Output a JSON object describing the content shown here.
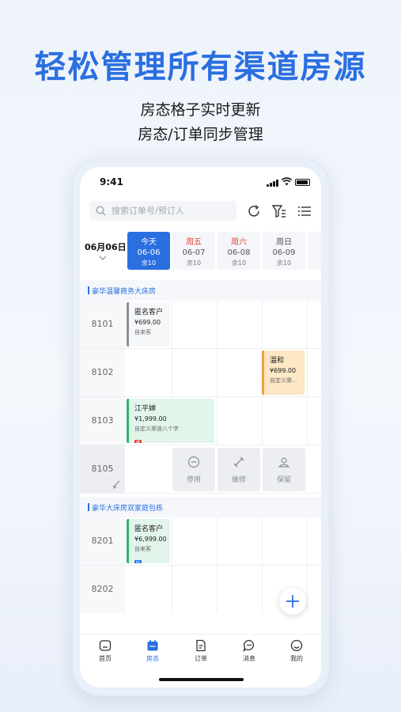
{
  "headline": "轻松管理所有渠道房源",
  "subline1": "房态格子实时更新",
  "subline2": "房态/订单同步管理",
  "status_bar": {
    "time": "9:41"
  },
  "search": {
    "placeholder": "搜索订单号/预订人"
  },
  "current_date": "06月06日",
  "dates": [
    {
      "weekday": "今天",
      "date": "06-06",
      "remain": "余10"
    },
    {
      "weekday": "周五",
      "date": "06-07",
      "remain": "余10"
    },
    {
      "weekday": "周六",
      "date": "06-08",
      "remain": "余10"
    },
    {
      "weekday": "周日",
      "date": "06-09",
      "remain": "余10"
    },
    {
      "weekday": "",
      "date": "0",
      "remain": ""
    }
  ],
  "categories": [
    "豪华温馨商务大床房",
    "豪华大床房双家庭包栋"
  ],
  "rooms": [
    "8101",
    "8102",
    "8103",
    "8105",
    "8201",
    "8202"
  ],
  "bookings": [
    {
      "name": "匿名客户",
      "price": "¥699.00",
      "channel": "自来客"
    },
    {
      "name": "温和",
      "price": "¥699.00",
      "channel": "自定义渠..."
    },
    {
      "name": "江平婵",
      "price": "¥1,999.00",
      "channel": "自定义渠道八个字",
      "tag": "美"
    },
    {
      "name": "匿名客户",
      "price": "¥6,999.00",
      "channel": "自来客",
      "tag": "包"
    }
  ],
  "actions": [
    {
      "label": "停用",
      "icon": "minus-circle-icon"
    },
    {
      "label": "維修",
      "icon": "wrench-icon"
    },
    {
      "label": "保留",
      "icon": "reserve-icon"
    }
  ],
  "tabs": [
    {
      "label": "首页",
      "icon": "home-icon"
    },
    {
      "label": "房态",
      "icon": "calendar-icon"
    },
    {
      "label": "订单",
      "icon": "order-icon"
    },
    {
      "label": "消息",
      "icon": "message-icon"
    },
    {
      "label": "我的",
      "icon": "profile-icon"
    }
  ],
  "colors": {
    "accent": "#2a6fe0",
    "weekend": "#e0443a",
    "orange": "#f0a13a",
    "green": "#31b36b"
  }
}
